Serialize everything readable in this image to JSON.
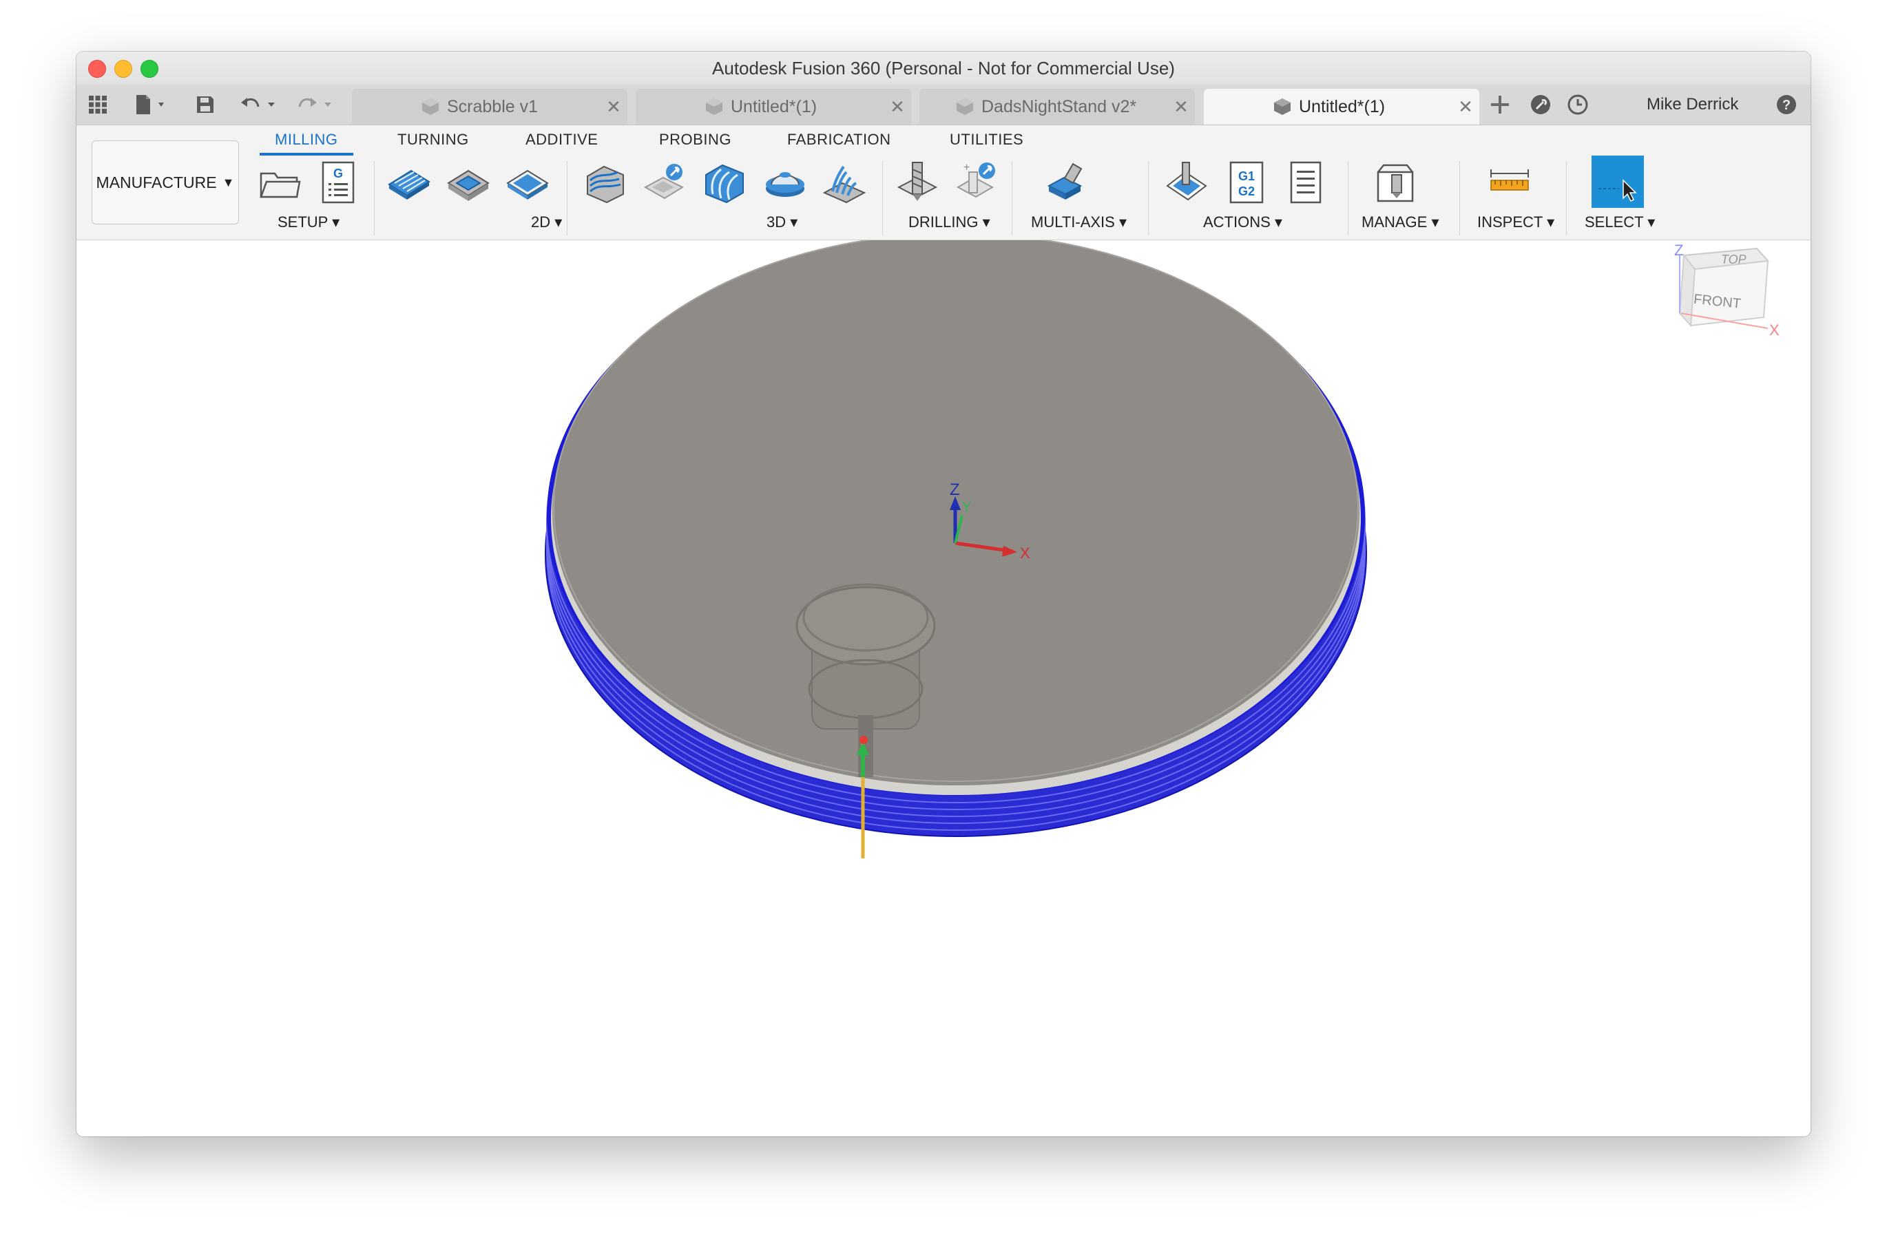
{
  "window": {
    "title": "Autodesk Fusion 360 (Personal - Not for Commercial Use)"
  },
  "tabs": [
    {
      "label": "Scrabble v1",
      "active": false
    },
    {
      "label": "Untitled*(1)",
      "active": false
    },
    {
      "label": "DadsNightStand v2*",
      "active": false
    },
    {
      "label": "Untitled*(1)",
      "active": true
    }
  ],
  "user": {
    "name": "Mike Derrick"
  },
  "toolbar_icons": [
    "grid-icon",
    "file-icon",
    "save-icon",
    "undo-icon",
    "redo-icon",
    "add-tab-icon",
    "extensions-icon",
    "job-status-icon",
    "help-icon"
  ],
  "workspace": {
    "label": "MANUFACTURE"
  },
  "ribbon_tabs": [
    {
      "label": "MILLING",
      "active": true
    },
    {
      "label": "TURNING",
      "active": false
    },
    {
      "label": "ADDITIVE",
      "active": false
    },
    {
      "label": "PROBING",
      "active": false
    },
    {
      "label": "FABRICATION",
      "active": false
    },
    {
      "label": "UTILITIES",
      "active": false
    }
  ],
  "groups": {
    "setup": "SETUP",
    "twod": "2D",
    "threed": "3D",
    "drilling": "DRILLING",
    "multiaxis": "MULTI-AXIS",
    "actions": "ACTIONS",
    "manage": "MANAGE",
    "inspect": "INSPECT",
    "select": "SELECT"
  },
  "viewcube": {
    "top": "TOP",
    "front": "FRONT",
    "z_axis": "Z",
    "x_axis": "X"
  },
  "origin_axes": {
    "z": "Z",
    "y": "Y",
    "x": "X"
  },
  "colors": {
    "accent": "#1a73c8",
    "toolpath": "#1b1bd6",
    "stock": "#8f8c87",
    "select_button": "#1c8fd6"
  }
}
